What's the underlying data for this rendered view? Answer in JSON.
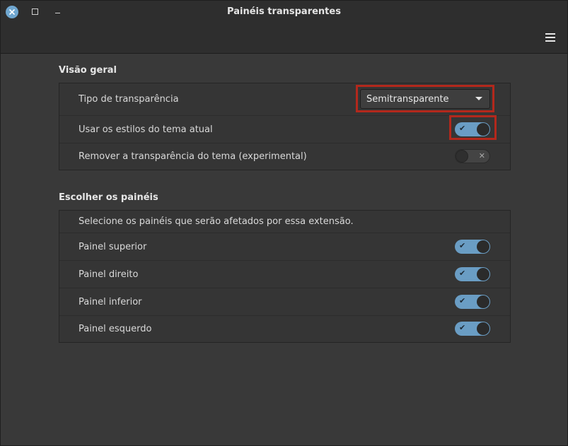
{
  "window": {
    "title": "Painéis transparentes"
  },
  "icons": {
    "close": "close-icon",
    "maximize": "maximize-icon",
    "minimize": "minimize-icon",
    "menu": "hamburger-menu-icon",
    "check": "✔",
    "cross": "✕"
  },
  "overview": {
    "heading": "Visão geral",
    "transparency_type": {
      "label": "Tipo de transparência",
      "selected": "Semitransparente"
    },
    "use_theme_styles": {
      "label": "Usar os estilos do tema atual",
      "state": true
    },
    "remove_theme_transparency": {
      "label": "Remover a transparência do tema (experimental)",
      "state": false
    }
  },
  "panels": {
    "heading": "Escolher os painéis",
    "description": "Selecione os painéis que serão afetados por essa extensão.",
    "items": [
      {
        "label": "Painel superior",
        "state": true
      },
      {
        "label": "Painel direito",
        "state": true
      },
      {
        "label": "Painel inferior",
        "state": true
      },
      {
        "label": "Painel esquerdo",
        "state": true
      }
    ]
  },
  "colors": {
    "accent": "#6a9dc4",
    "highlight": "#b3281c",
    "background": "#393939"
  }
}
